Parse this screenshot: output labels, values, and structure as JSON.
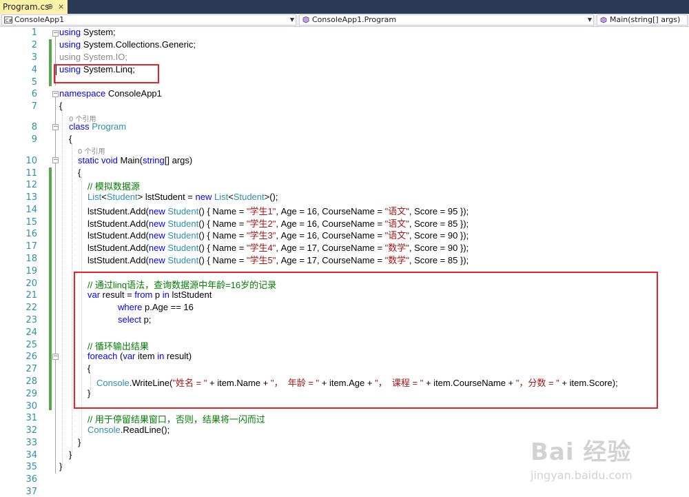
{
  "tab": {
    "label": "Program.cs",
    "pin": "⊕",
    "close": "×"
  },
  "nav": {
    "project": "ConsoleApp1",
    "class": "ConsoleApp1.Program",
    "member": "Main(string[] args)"
  },
  "line_numbers": [
    "1",
    "2",
    "3",
    "4",
    "5",
    "6",
    "7",
    "8",
    "9",
    "10",
    "11",
    "12",
    "13",
    "14",
    "15",
    "16",
    "17",
    "18",
    "19",
    "20",
    "21",
    "22",
    "23",
    "24",
    "25",
    "26",
    "27",
    "28",
    "29",
    "30",
    "31",
    "32",
    "33",
    "34",
    "35",
    "36",
    "37"
  ],
  "codelens": {
    "refs_a": "0 个引用",
    "refs_b": "0 个引用"
  },
  "code": {
    "l1": [
      "using",
      " System;"
    ],
    "l2": [
      "using",
      " System.Collections.Generic;"
    ],
    "l3": "using System.IO;",
    "l4": [
      "using",
      " System.Linq;"
    ],
    "l6": [
      "namespace",
      " ConsoleApp1"
    ],
    "l7": "{",
    "l8": [
      "class",
      " ",
      "Program"
    ],
    "l9": "{",
    "l10": [
      "static",
      " ",
      "void",
      " Main(",
      "string",
      "[] args)"
    ],
    "l11": "{",
    "l12": "// 模拟数据源",
    "l13": [
      "List",
      "<",
      "Student",
      "> lstStudent = ",
      "new",
      " ",
      "List",
      "<",
      "Student",
      ">();"
    ],
    "add_rows": [
      {
        "a": "lstStudent.Add(",
        "b": "new",
        "c": " ",
        "d": "Student",
        "e": "() { Name = ",
        "f": "\"学生1\"",
        "g": ", Age = 16, CourseName = ",
        "h": "\"语文\"",
        "i": ", Score = 95 });"
      },
      {
        "a": "lstStudent.Add(",
        "b": "new",
        "c": " ",
        "d": "Student",
        "e": "() { Name = ",
        "f": "\"学生2\"",
        "g": ", Age = 16, CourseName = ",
        "h": "\"语文\"",
        "i": ", Score = 85 });"
      },
      {
        "a": "lstStudent.Add(",
        "b": "new",
        "c": " ",
        "d": "Student",
        "e": "() { Name = ",
        "f": "\"学生3\"",
        "g": ", Age = 16, CourseName = ",
        "h": "\"语文\"",
        "i": ", Score = 90 });"
      },
      {
        "a": "lstStudent.Add(",
        "b": "new",
        "c": " ",
        "d": "Student",
        "e": "() { Name = ",
        "f": "\"学生4\"",
        "g": ", Age = 17, CourseName = ",
        "h": "\"数学\"",
        "i": ", Score = 90 });"
      },
      {
        "a": "lstStudent.Add(",
        "b": "new",
        "c": " ",
        "d": "Student",
        "e": "() { Name = ",
        "f": "\"学生5\"",
        "g": ", Age = 17, CourseName = ",
        "h": "\"数学\"",
        "i": ", Score = 85 });"
      }
    ],
    "l20": "// 通过linq语法，查询数据源中年龄=16岁的记录",
    "l21": [
      "var",
      " result = ",
      "from",
      " p ",
      "in",
      " lstStudent"
    ],
    "l22": [
      "where",
      " p.Age == 16"
    ],
    "l23": [
      "select",
      " p;"
    ],
    "l25": "// 循环输出结果",
    "l26": [
      "foreach",
      " (",
      "var",
      " item ",
      "in",
      " result)"
    ],
    "l27": "{",
    "l28": [
      "Console",
      ".WriteLine(",
      "\"姓名 = \"",
      " + item.Name + ",
      "\"，  年龄 = \"",
      " + item.Age + ",
      "\"，  课程 = \"",
      " + item.CourseName + ",
      "\"，分数 = \"",
      " + item.Score);"
    ],
    "l29": "}",
    "l31": "// 用于停留结果窗口，否则，结果将一闪而过",
    "l32": [
      "Console",
      ".ReadLine();"
    ],
    "l33": "}",
    "l34": "}",
    "l35": "}"
  },
  "colors": {
    "keyword": "#0000ff",
    "type": "#2b91af",
    "string": "#a31515",
    "comment": "#008000",
    "highlight": "#e8202a",
    "tab_active": "#fff1a8"
  },
  "watermark": {
    "big": "Bai 经验",
    "small": "jingyan.baidu.com"
  }
}
